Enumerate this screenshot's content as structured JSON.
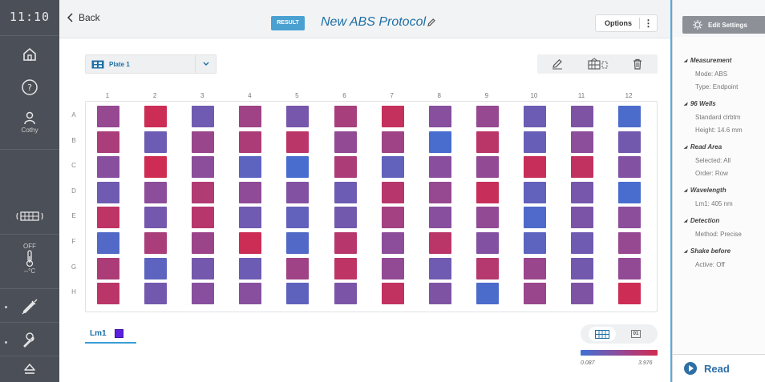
{
  "rail": {
    "clock": "11:10",
    "user_label": "Cothy",
    "temp_label": "OFF",
    "temp_unit": "--°C"
  },
  "header": {
    "back_label": "Back",
    "result_badge": "RESULT",
    "protocol_title": "New ABS Protocol",
    "options_label": "Options"
  },
  "plate": {
    "selected_plate": "Plate 1",
    "columns": [
      "1",
      "2",
      "3",
      "4",
      "5",
      "6",
      "7",
      "8",
      "9",
      "10",
      "11",
      "12"
    ],
    "rows": [
      "A",
      "B",
      "C",
      "D",
      "E",
      "F",
      "G",
      "H"
    ],
    "wells": [
      [
        0.55,
        0.95,
        0.3,
        0.62,
        0.35,
        0.68,
        0.9,
        0.45,
        0.55,
        0.28,
        0.4,
        0.08
      ],
      [
        0.7,
        0.28,
        0.58,
        0.72,
        0.82,
        0.52,
        0.62,
        0.06,
        0.82,
        0.25,
        0.48,
        0.32
      ],
      [
        0.45,
        0.97,
        0.48,
        0.18,
        0.06,
        0.72,
        0.22,
        0.46,
        0.52,
        0.92,
        0.88,
        0.42
      ],
      [
        0.3,
        0.48,
        0.75,
        0.5,
        0.42,
        0.28,
        0.8,
        0.55,
        0.92,
        0.22,
        0.35,
        0.06
      ],
      [
        0.85,
        0.33,
        0.8,
        0.3,
        0.22,
        0.32,
        0.65,
        0.45,
        0.52,
        0.1,
        0.38,
        0.48
      ],
      [
        0.12,
        0.7,
        0.6,
        0.95,
        0.12,
        0.8,
        0.48,
        0.82,
        0.42,
        0.18,
        0.3,
        0.55
      ],
      [
        0.72,
        0.18,
        0.33,
        0.28,
        0.62,
        0.85,
        0.52,
        0.3,
        0.78,
        0.58,
        0.32,
        0.52
      ],
      [
        0.82,
        0.32,
        0.45,
        0.45,
        0.2,
        0.38,
        0.88,
        0.4,
        0.08,
        0.58,
        0.4,
        0.96
      ]
    ]
  },
  "wavelength_tab": {
    "label": "Lm1",
    "color": "#5b1fe0"
  },
  "view_toggle": {
    "numeric_label": "01"
  },
  "legend": {
    "min": "0.087",
    "max": "3.976",
    "low_color": "#3f72d6",
    "mid_color": "#8f4b98",
    "high_color": "#d22a4e"
  },
  "settings": {
    "edit_label": "Edit Settings",
    "sections": [
      {
        "title": "Measurement",
        "lines": [
          "Mode: ABS",
          "Type: Endpoint"
        ]
      },
      {
        "title": "96 Wells",
        "lines": [
          "Standard clrbtm",
          "Height: 14.6 mm"
        ]
      },
      {
        "title": "Read Area",
        "lines": [
          "Selected: All",
          "Order: Row"
        ]
      },
      {
        "title": "Wavelength",
        "lines": [
          "Lm1: 405 nm"
        ]
      },
      {
        "title": "Detection",
        "lines": [
          "Method: Precise"
        ]
      },
      {
        "title": "Shake before",
        "lines": [
          "Active: Off"
        ]
      }
    ],
    "read_label": "Read"
  }
}
